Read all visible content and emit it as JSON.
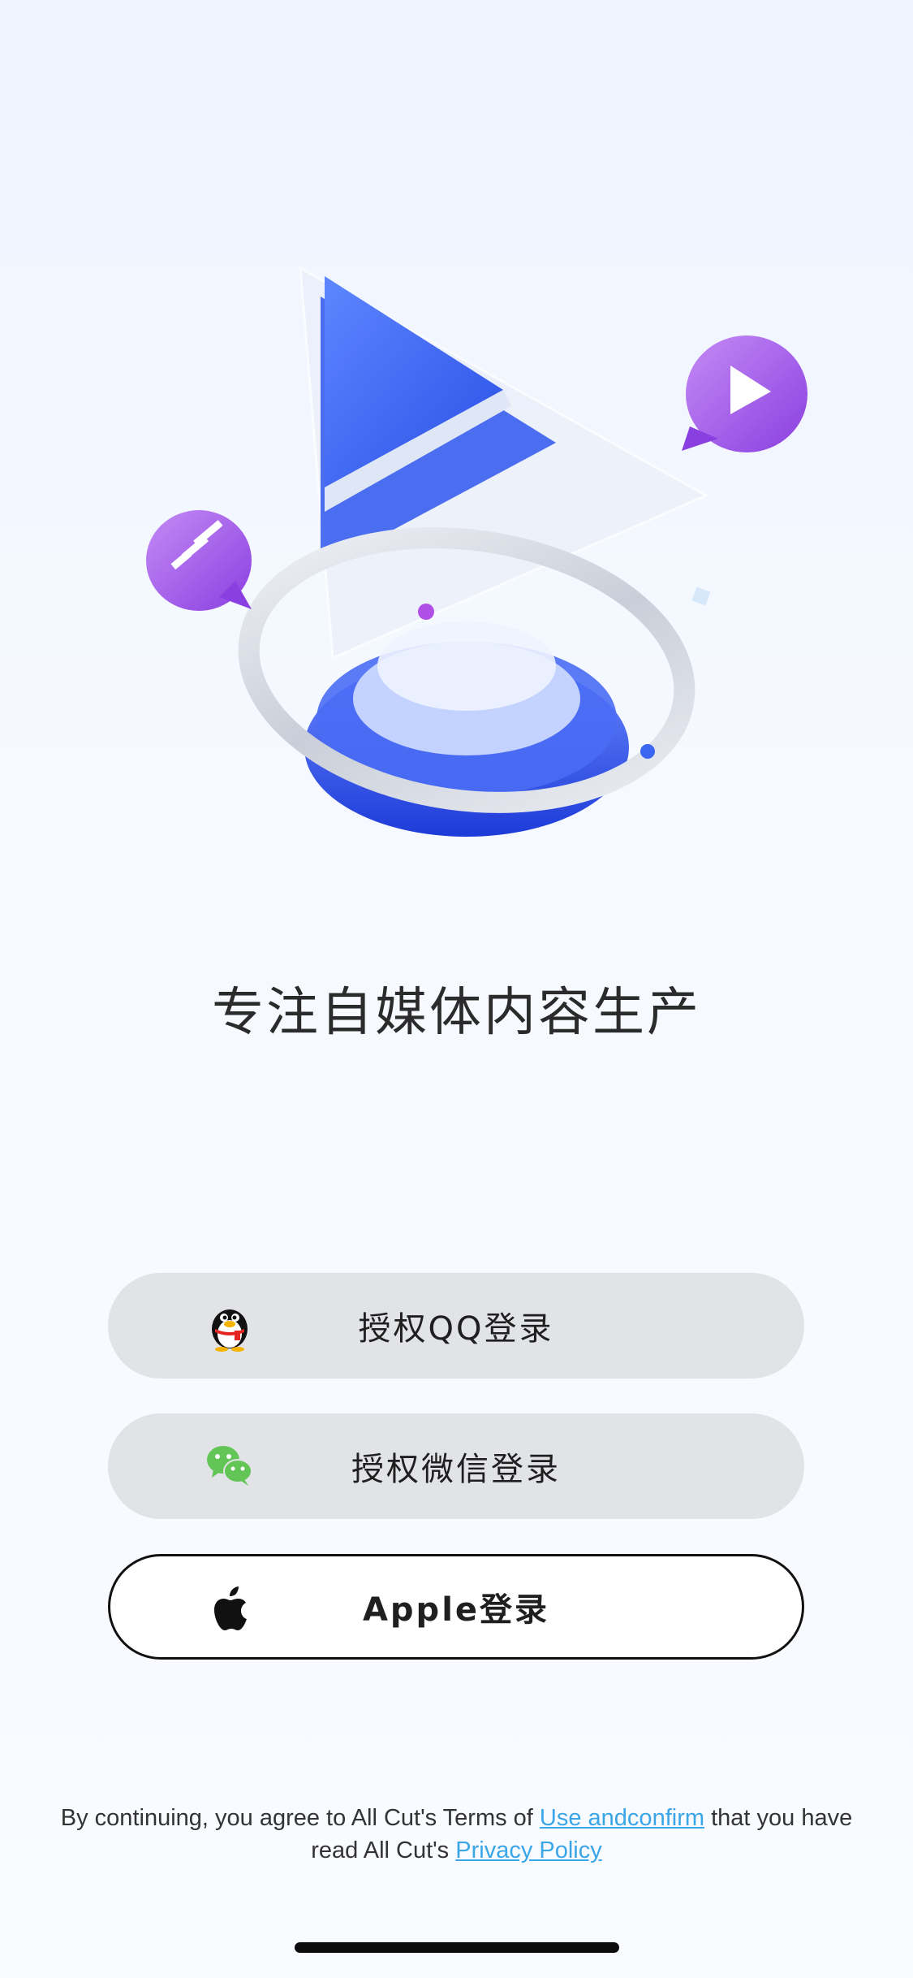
{
  "tagline": "专注自媒体内容生产",
  "buttons": {
    "qq": {
      "label": "授权QQ登录",
      "icon": "qq-penguin-icon"
    },
    "wechat": {
      "label": "授权微信登录",
      "icon": "wechat-icon"
    },
    "apple": {
      "label": "Apple登录",
      "icon": "apple-icon"
    }
  },
  "terms": {
    "prefix": "By continuing, you agree to All Cut's Terms of ",
    "terms_link": "Use andconfirm",
    "middle": " that you have read All Cut's ",
    "privacy_link": "Privacy Policy"
  },
  "colors": {
    "link": "#3aa6e8",
    "button_bg": "#e2e3e6",
    "accent_blue": "#3a66f2",
    "accent_purple": "#a45ae6"
  }
}
